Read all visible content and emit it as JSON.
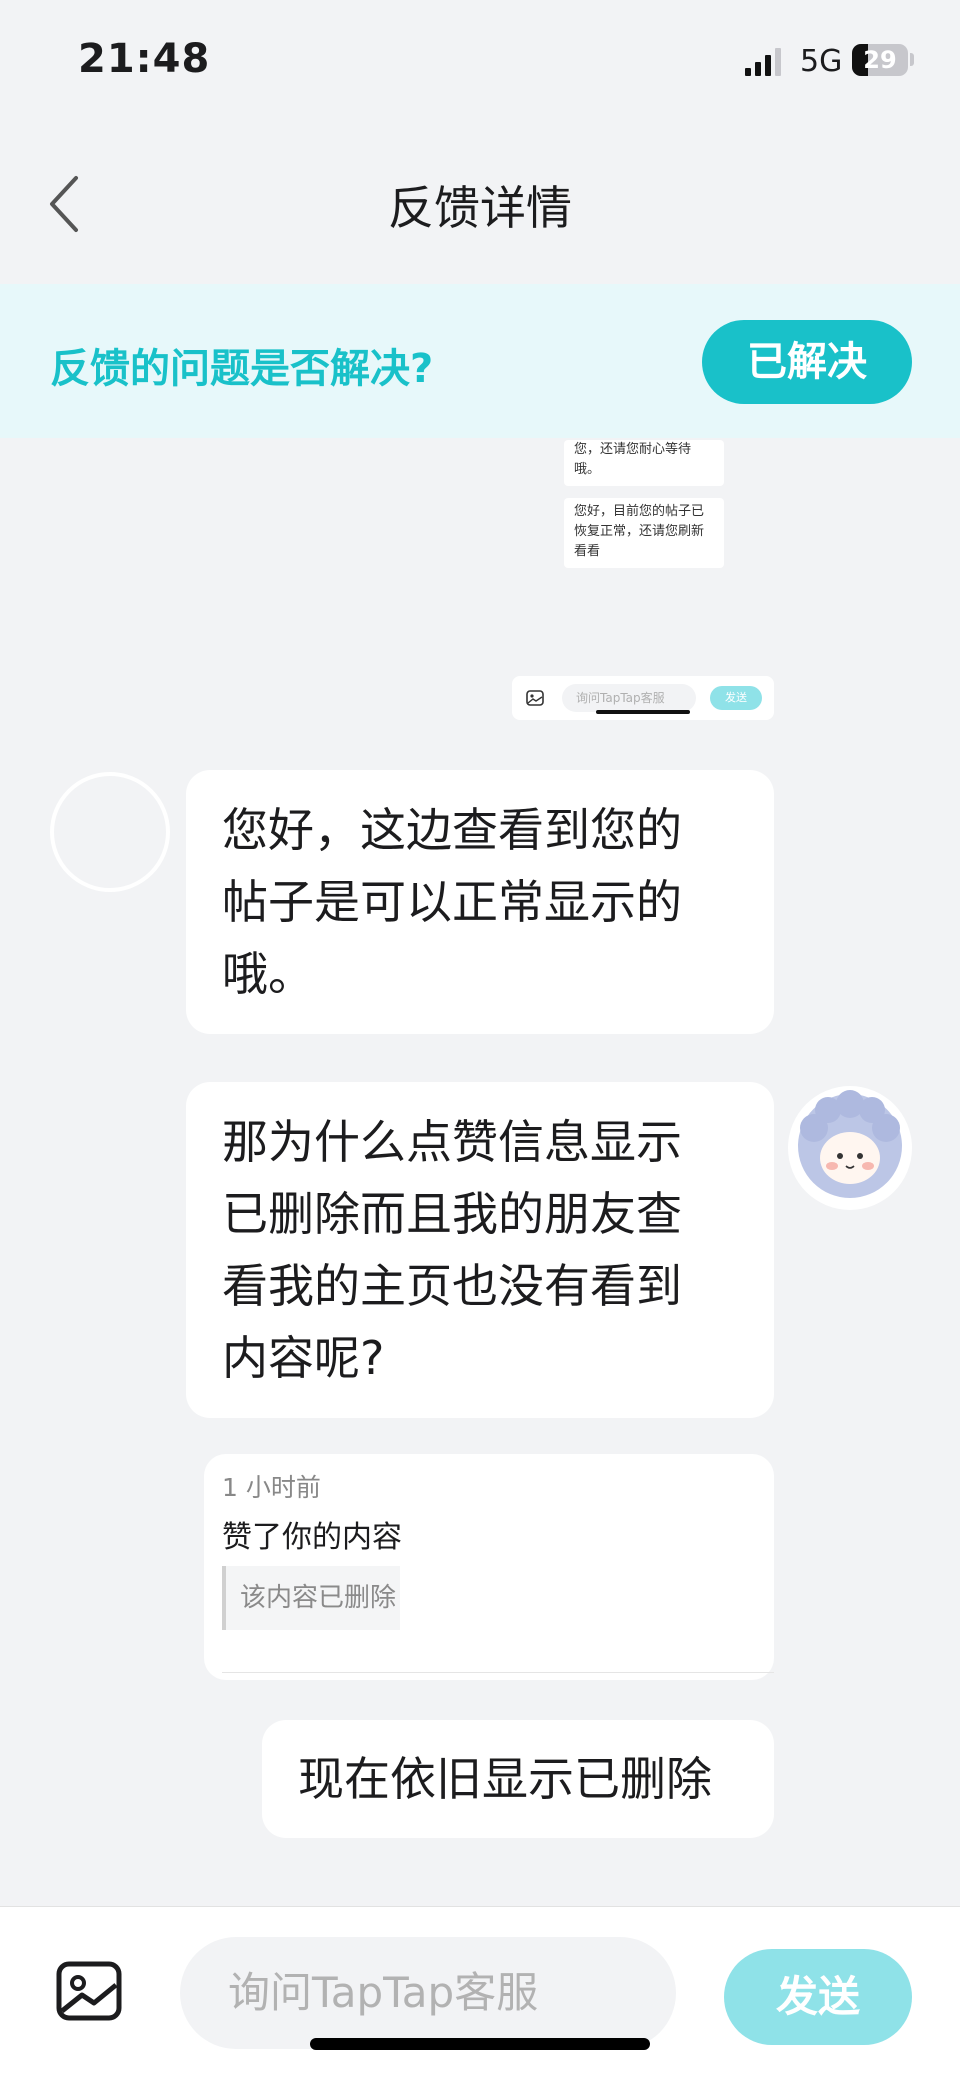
{
  "status_bar": {
    "time": "21:48",
    "network": "5G",
    "battery": "29"
  },
  "header": {
    "title": "反馈详情",
    "back_icon": "chevron-left-icon"
  },
  "resolve_banner": {
    "question": "反馈的问题是否解决?",
    "button_label": "已解决",
    "accent_color": "#19c1c9"
  },
  "embedded_screenshot": {
    "messages": [
      {
        "lines": [
          "您，还请您耐心等待",
          "哦。"
        ]
      },
      {
        "lines": [
          "您好，目前您的帖子已",
          "恢复正常，还请您刷新",
          "看看"
        ]
      }
    ],
    "input_placeholder": "询问TapTap客服",
    "send_label": "发送"
  },
  "messages": [
    {
      "from": "support",
      "lines": [
        "您好，这边查看到您的",
        "帖子是可以正常显示的",
        "哦。"
      ]
    },
    {
      "from": "user",
      "lines": [
        "那为什么点赞信息显示",
        "已删除而且我的朋友查",
        "看我的主页也没有看到",
        "内容呢?"
      ]
    },
    {
      "from": "user",
      "type": "image",
      "card": {
        "time": "1 小时前",
        "text": "赞了你的内容",
        "quote": "该内容已删除"
      }
    },
    {
      "from": "user",
      "lines": [
        "现在依旧显示已删除"
      ]
    }
  ],
  "composer": {
    "image_icon": "image-icon",
    "placeholder": "询问TapTap客服",
    "send_label": "发送",
    "send_color": "#8fe2e8"
  }
}
